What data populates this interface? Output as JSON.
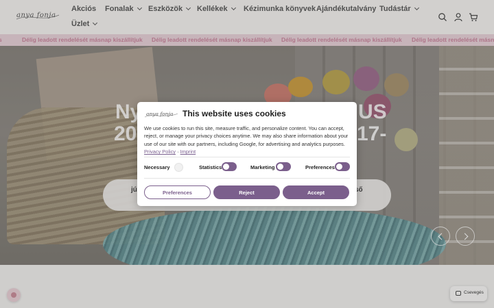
{
  "header": {
    "logo_text": "anya fonja",
    "nav": [
      {
        "label": "Akciós",
        "dropdown": false
      },
      {
        "label": "Fonalak",
        "dropdown": true
      },
      {
        "label": "Eszközök",
        "dropdown": true
      },
      {
        "label": "Kellékek",
        "dropdown": true
      },
      {
        "label": "Kézimunka könyvek",
        "dropdown": false
      },
      {
        "label": "Ajándékutalvány",
        "dropdown": false
      },
      {
        "label": "Tudástár",
        "dropdown": true
      },
      {
        "label": "Üzlet",
        "dropdown": true
      }
    ],
    "icons": [
      "search-icon",
      "account-icon",
      "cart-icon"
    ]
  },
  "announcement": {
    "text": "Délig leadott rendelését másnap kiszállítjuk"
  },
  "hero": {
    "title_line1_left": "Ny",
    "title_line1_right": "US",
    "title_line2_left": "20",
    "title_line2_right": "17-",
    "pill_left": "júl",
    "pill_right": "ső"
  },
  "cookie_modal": {
    "logo_text": "anya fonja",
    "title": "This website uses cookies",
    "body": "We use cookies to run this site, measure traffic, and personalize content. You can accept, reject, or manage your privacy choices anytime. We may also share information about your use of our site with our partners, including Google, for advertising and analytics purposes.",
    "privacy_link": "Privacy Policy",
    "link_separator": "·",
    "imprint_link": "Imprint",
    "toggles": [
      {
        "label": "Necessary",
        "on": true,
        "disabled": true
      },
      {
        "label": "Statistics",
        "on": true,
        "disabled": false
      },
      {
        "label": "Marketing",
        "on": true,
        "disabled": false
      },
      {
        "label": "Preferences",
        "on": true,
        "disabled": false
      }
    ],
    "buttons": {
      "preferences": "Preferences",
      "reject": "Reject",
      "accept": "Accept"
    },
    "accent_color": "#7b5f8c"
  },
  "chat": {
    "label": "Csevegés"
  },
  "colors": {
    "announcement_bg": "#e6cfd6",
    "announcement_text": "#c7829a",
    "header_bg": "#f3f1ee"
  }
}
